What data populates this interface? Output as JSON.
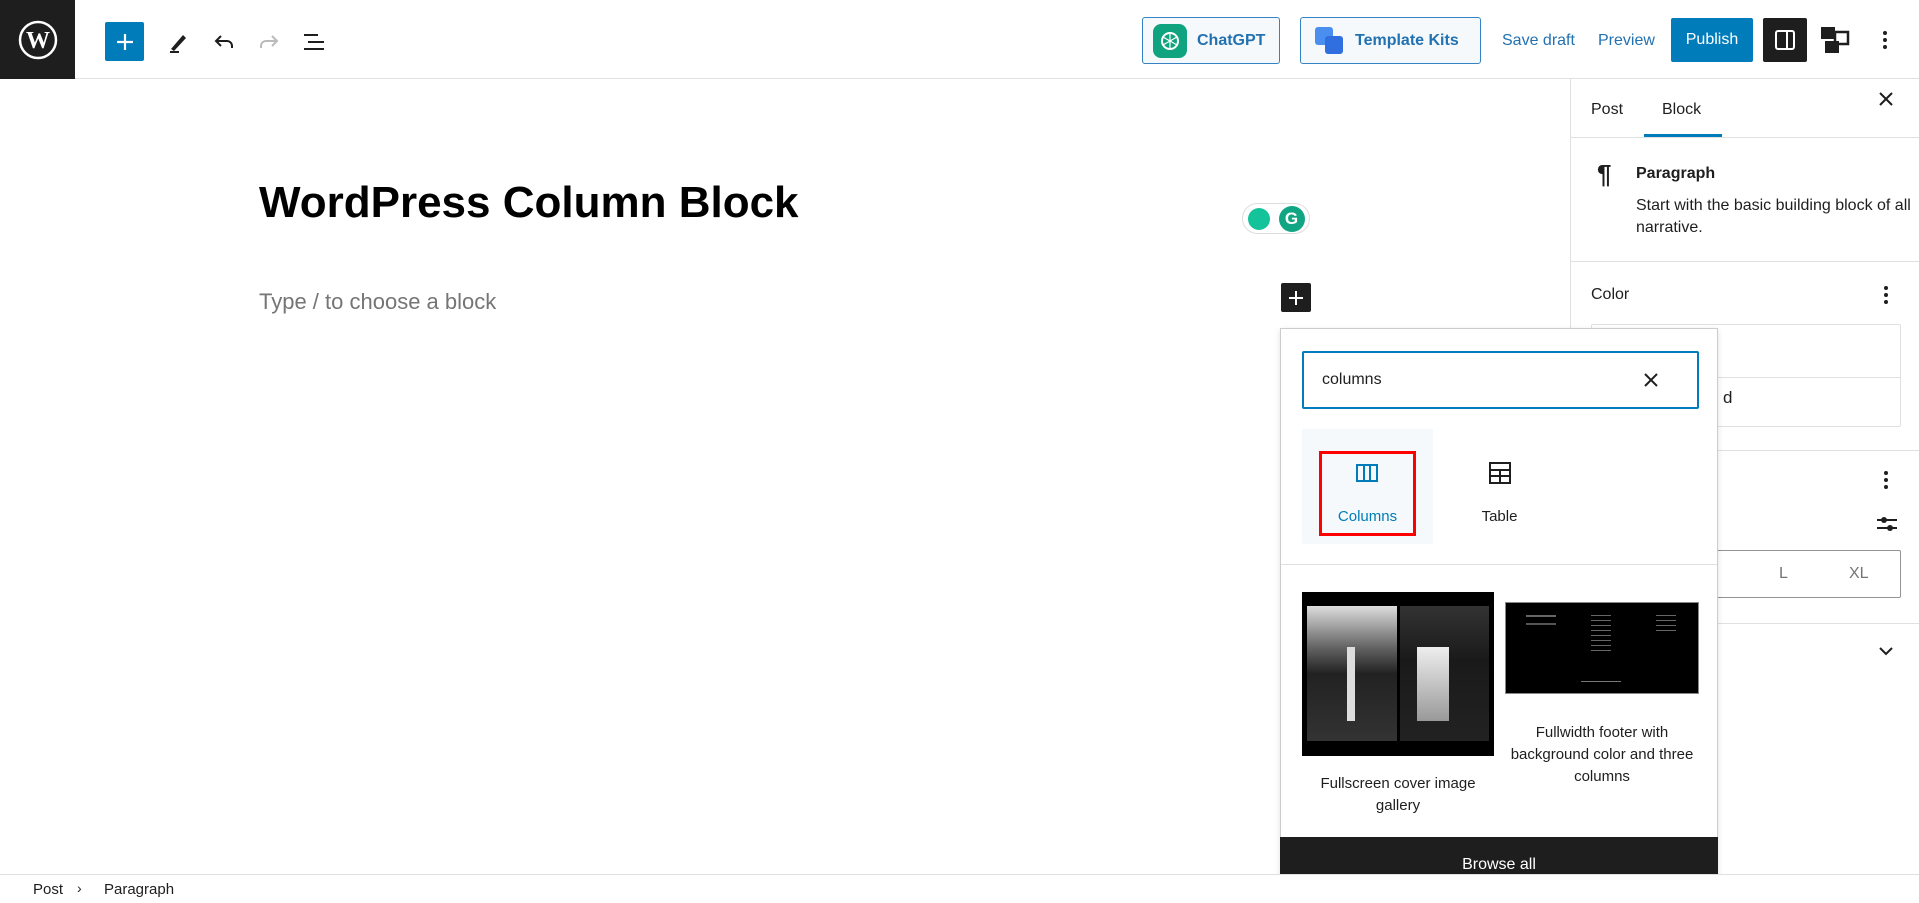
{
  "toolbar": {
    "logo": "wordpress-logo",
    "add_block_icon": "plus-icon",
    "tools_icon": "pencil-icon",
    "undo_icon": "undo-icon",
    "redo_icon": "redo-icon",
    "list_view_icon": "list-view-icon",
    "chatgpt_label": "ChatGPT",
    "template_kits_label": "Template Kits",
    "save_draft_label": "Save draft",
    "preview_label": "Preview",
    "publish_label": "Publish",
    "accent_color": "#007cba"
  },
  "editor": {
    "title": "WordPress Column Block",
    "placeholder": "Type / to choose a block"
  },
  "sidebar": {
    "tabs": [
      {
        "label": "Post",
        "active": false
      },
      {
        "label": "Block",
        "active": true
      }
    ],
    "block_name": "Paragraph",
    "block_description": "Start with the basic building block of all narrative.",
    "color_heading": "Color",
    "color_partial_text": "d",
    "size_options": [
      "L",
      "XL"
    ]
  },
  "inserter": {
    "search_value": "columns",
    "blocks": [
      {
        "label": "Columns",
        "icon": "columns-icon",
        "highlighted": true
      },
      {
        "label": "Table",
        "icon": "table-icon",
        "highlighted": false
      }
    ],
    "patterns": [
      {
        "label": "Fullscreen cover image gallery"
      },
      {
        "label": "Fullwidth footer with background color and three columns"
      }
    ],
    "browse_all_label": "Browse all",
    "highlight_color": "#ff0000"
  },
  "breadcrumb": {
    "items": [
      "Post",
      "Paragraph"
    ]
  }
}
